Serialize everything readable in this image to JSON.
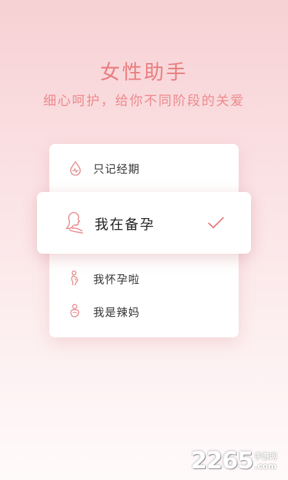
{
  "header": {
    "title": "女性助手",
    "subtitle": "细心呵护，给你不同阶段的关爱"
  },
  "modes": [
    {
      "label": "只记经期",
      "icon": "drop-heartbeat-icon",
      "selected": false
    },
    {
      "label": "我在备孕",
      "icon": "woman-profile-icon",
      "selected": true
    },
    {
      "label": "我怀孕啦",
      "icon": "pregnant-icon",
      "selected": false
    },
    {
      "label": "我是辣妈",
      "icon": "baby-icon",
      "selected": false
    }
  ],
  "watermark": {
    "number": "2265",
    "site_cn": "手游网",
    "site_en": ".com"
  },
  "colors": {
    "accent": "#e97e80",
    "text": "#333333",
    "icon_stroke": "#e68c8e"
  }
}
